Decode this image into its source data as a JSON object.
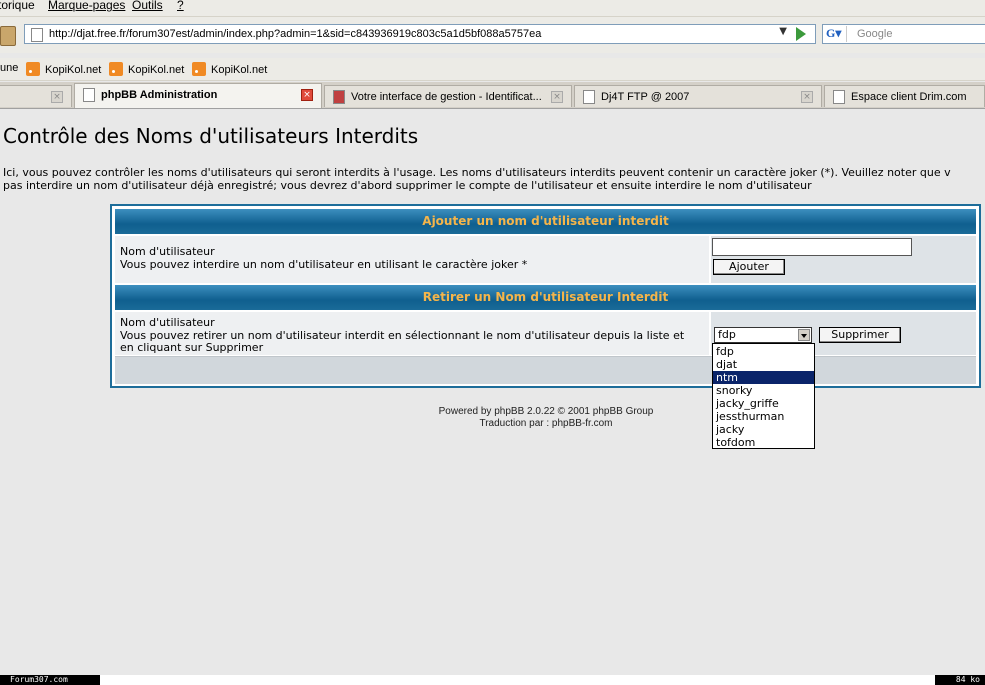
{
  "menu": [
    "torique",
    "Marque-pages",
    "Outils",
    "?"
  ],
  "nav": {
    "url": "http://djat.free.fr/forum307est/admin/index.php?admin=1&sid=c843936919c803c5a1d5bf088a5757ea",
    "search_placeholder": "Google",
    "search_engine_icon": "google-icon"
  },
  "bookmarks": [
    "une",
    "KopiKol.net",
    "KopiKol.net",
    "KopiKol.net"
  ],
  "tabs": [
    {
      "label": "phpBB Administration",
      "active": true
    },
    {
      "label": "Votre interface de gestion - Identificat...",
      "active": false
    },
    {
      "label": "Dj4T FTP @ 2007",
      "active": false
    },
    {
      "label": "Espace client Drim.com",
      "active": false
    }
  ],
  "page": {
    "title": "Contrôle des Noms d'utilisateurs Interdits",
    "intro_line1": "Ici, vous pouvez contrôler les noms d'utilisateurs qui seront interdits à l'usage. Les noms d'utilisateurs interdits peuvent contenir un caractère joker (*). Veuillez noter que v",
    "intro_line2": "pas interdire un nom d'utilisateur déjà enregistré; vous devrez d'abord supprimer le compte de l'utilisateur et ensuite interdire le nom d'utilisateur"
  },
  "add_section": {
    "header": "Ajouter un nom d'utilisateur interdit",
    "label": "Nom d'utilisateur",
    "help": "Vous pouvez interdire un nom d'utilisateur en utilisant le caractère joker *",
    "input_value": "",
    "button": "Ajouter"
  },
  "remove_section": {
    "header": "Retirer un Nom d'utilisateur Interdit",
    "label": "Nom d'utilisateur",
    "help_line1": "Vous pouvez retirer un nom d'utilisateur interdit en sélectionnant le nom d'utilisateur depuis la liste et",
    "help_line2": "en cliquant sur Supprimer",
    "selected": "fdp",
    "button": "Supprimer",
    "options": [
      "fdp",
      "djat",
      "ntm",
      "snorky",
      "jacky_griffe",
      "jessthurman",
      "jacky",
      "tofdom"
    ],
    "highlighted_option": "ntm"
  },
  "footer": {
    "powered": "Powered by phpBB 2.0.22 © 2001 phpBB Group",
    "translation": "Traduction par : phpBB-fr.com"
  },
  "status": {
    "left": "Forum307.com",
    "right": "84 ko"
  },
  "colors": {
    "cathead": "#0f5f8f",
    "cathead_text": "#f5b54a",
    "selection": "#0a246a"
  }
}
